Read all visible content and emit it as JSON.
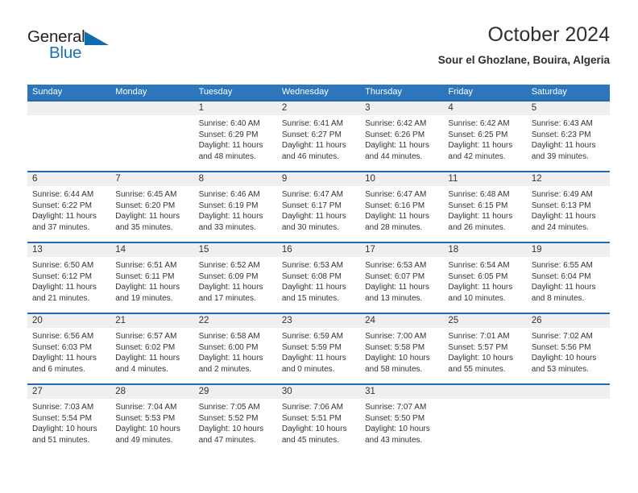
{
  "brand": {
    "name_primary": "General",
    "name_secondary": "Blue",
    "accent_color": "#0e6cb0"
  },
  "header": {
    "title": "October 2024",
    "subtitle": "Sour el Ghozlane, Bouira, Algeria"
  },
  "calendar": {
    "header_color": "#2d76bb",
    "row_divider_color": "#2269ad",
    "day_band_color": "#efefef",
    "weekdays": [
      "Sunday",
      "Monday",
      "Tuesday",
      "Wednesday",
      "Thursday",
      "Friday",
      "Saturday"
    ],
    "weeks": [
      [
        {
          "empty": true
        },
        {
          "empty": true
        },
        {
          "day": "1",
          "sunrise": "Sunrise: 6:40 AM",
          "sunset": "Sunset: 6:29 PM",
          "daylight": "Daylight: 11 hours and 48 minutes."
        },
        {
          "day": "2",
          "sunrise": "Sunrise: 6:41 AM",
          "sunset": "Sunset: 6:27 PM",
          "daylight": "Daylight: 11 hours and 46 minutes."
        },
        {
          "day": "3",
          "sunrise": "Sunrise: 6:42 AM",
          "sunset": "Sunset: 6:26 PM",
          "daylight": "Daylight: 11 hours and 44 minutes."
        },
        {
          "day": "4",
          "sunrise": "Sunrise: 6:42 AM",
          "sunset": "Sunset: 6:25 PM",
          "daylight": "Daylight: 11 hours and 42 minutes."
        },
        {
          "day": "5",
          "sunrise": "Sunrise: 6:43 AM",
          "sunset": "Sunset: 6:23 PM",
          "daylight": "Daylight: 11 hours and 39 minutes."
        }
      ],
      [
        {
          "day": "6",
          "sunrise": "Sunrise: 6:44 AM",
          "sunset": "Sunset: 6:22 PM",
          "daylight": "Daylight: 11 hours and 37 minutes."
        },
        {
          "day": "7",
          "sunrise": "Sunrise: 6:45 AM",
          "sunset": "Sunset: 6:20 PM",
          "daylight": "Daylight: 11 hours and 35 minutes."
        },
        {
          "day": "8",
          "sunrise": "Sunrise: 6:46 AM",
          "sunset": "Sunset: 6:19 PM",
          "daylight": "Daylight: 11 hours and 33 minutes."
        },
        {
          "day": "9",
          "sunrise": "Sunrise: 6:47 AM",
          "sunset": "Sunset: 6:17 PM",
          "daylight": "Daylight: 11 hours and 30 minutes."
        },
        {
          "day": "10",
          "sunrise": "Sunrise: 6:47 AM",
          "sunset": "Sunset: 6:16 PM",
          "daylight": "Daylight: 11 hours and 28 minutes."
        },
        {
          "day": "11",
          "sunrise": "Sunrise: 6:48 AM",
          "sunset": "Sunset: 6:15 PM",
          "daylight": "Daylight: 11 hours and 26 minutes."
        },
        {
          "day": "12",
          "sunrise": "Sunrise: 6:49 AM",
          "sunset": "Sunset: 6:13 PM",
          "daylight": "Daylight: 11 hours and 24 minutes."
        }
      ],
      [
        {
          "day": "13",
          "sunrise": "Sunrise: 6:50 AM",
          "sunset": "Sunset: 6:12 PM",
          "daylight": "Daylight: 11 hours and 21 minutes."
        },
        {
          "day": "14",
          "sunrise": "Sunrise: 6:51 AM",
          "sunset": "Sunset: 6:11 PM",
          "daylight": "Daylight: 11 hours and 19 minutes."
        },
        {
          "day": "15",
          "sunrise": "Sunrise: 6:52 AM",
          "sunset": "Sunset: 6:09 PM",
          "daylight": "Daylight: 11 hours and 17 minutes."
        },
        {
          "day": "16",
          "sunrise": "Sunrise: 6:53 AM",
          "sunset": "Sunset: 6:08 PM",
          "daylight": "Daylight: 11 hours and 15 minutes."
        },
        {
          "day": "17",
          "sunrise": "Sunrise: 6:53 AM",
          "sunset": "Sunset: 6:07 PM",
          "daylight": "Daylight: 11 hours and 13 minutes."
        },
        {
          "day": "18",
          "sunrise": "Sunrise: 6:54 AM",
          "sunset": "Sunset: 6:05 PM",
          "daylight": "Daylight: 11 hours and 10 minutes."
        },
        {
          "day": "19",
          "sunrise": "Sunrise: 6:55 AM",
          "sunset": "Sunset: 6:04 PM",
          "daylight": "Daylight: 11 hours and 8 minutes."
        }
      ],
      [
        {
          "day": "20",
          "sunrise": "Sunrise: 6:56 AM",
          "sunset": "Sunset: 6:03 PM",
          "daylight": "Daylight: 11 hours and 6 minutes."
        },
        {
          "day": "21",
          "sunrise": "Sunrise: 6:57 AM",
          "sunset": "Sunset: 6:02 PM",
          "daylight": "Daylight: 11 hours and 4 minutes."
        },
        {
          "day": "22",
          "sunrise": "Sunrise: 6:58 AM",
          "sunset": "Sunset: 6:00 PM",
          "daylight": "Daylight: 11 hours and 2 minutes."
        },
        {
          "day": "23",
          "sunrise": "Sunrise: 6:59 AM",
          "sunset": "Sunset: 5:59 PM",
          "daylight": "Daylight: 11 hours and 0 minutes."
        },
        {
          "day": "24",
          "sunrise": "Sunrise: 7:00 AM",
          "sunset": "Sunset: 5:58 PM",
          "daylight": "Daylight: 10 hours and 58 minutes."
        },
        {
          "day": "25",
          "sunrise": "Sunrise: 7:01 AM",
          "sunset": "Sunset: 5:57 PM",
          "daylight": "Daylight: 10 hours and 55 minutes."
        },
        {
          "day": "26",
          "sunrise": "Sunrise: 7:02 AM",
          "sunset": "Sunset: 5:56 PM",
          "daylight": "Daylight: 10 hours and 53 minutes."
        }
      ],
      [
        {
          "day": "27",
          "sunrise": "Sunrise: 7:03 AM",
          "sunset": "Sunset: 5:54 PM",
          "daylight": "Daylight: 10 hours and 51 minutes."
        },
        {
          "day": "28",
          "sunrise": "Sunrise: 7:04 AM",
          "sunset": "Sunset: 5:53 PM",
          "daylight": "Daylight: 10 hours and 49 minutes."
        },
        {
          "day": "29",
          "sunrise": "Sunrise: 7:05 AM",
          "sunset": "Sunset: 5:52 PM",
          "daylight": "Daylight: 10 hours and 47 minutes."
        },
        {
          "day": "30",
          "sunrise": "Sunrise: 7:06 AM",
          "sunset": "Sunset: 5:51 PM",
          "daylight": "Daylight: 10 hours and 45 minutes."
        },
        {
          "day": "31",
          "sunrise": "Sunrise: 7:07 AM",
          "sunset": "Sunset: 5:50 PM",
          "daylight": "Daylight: 10 hours and 43 minutes."
        },
        {
          "empty": true
        },
        {
          "empty": true
        }
      ]
    ]
  }
}
